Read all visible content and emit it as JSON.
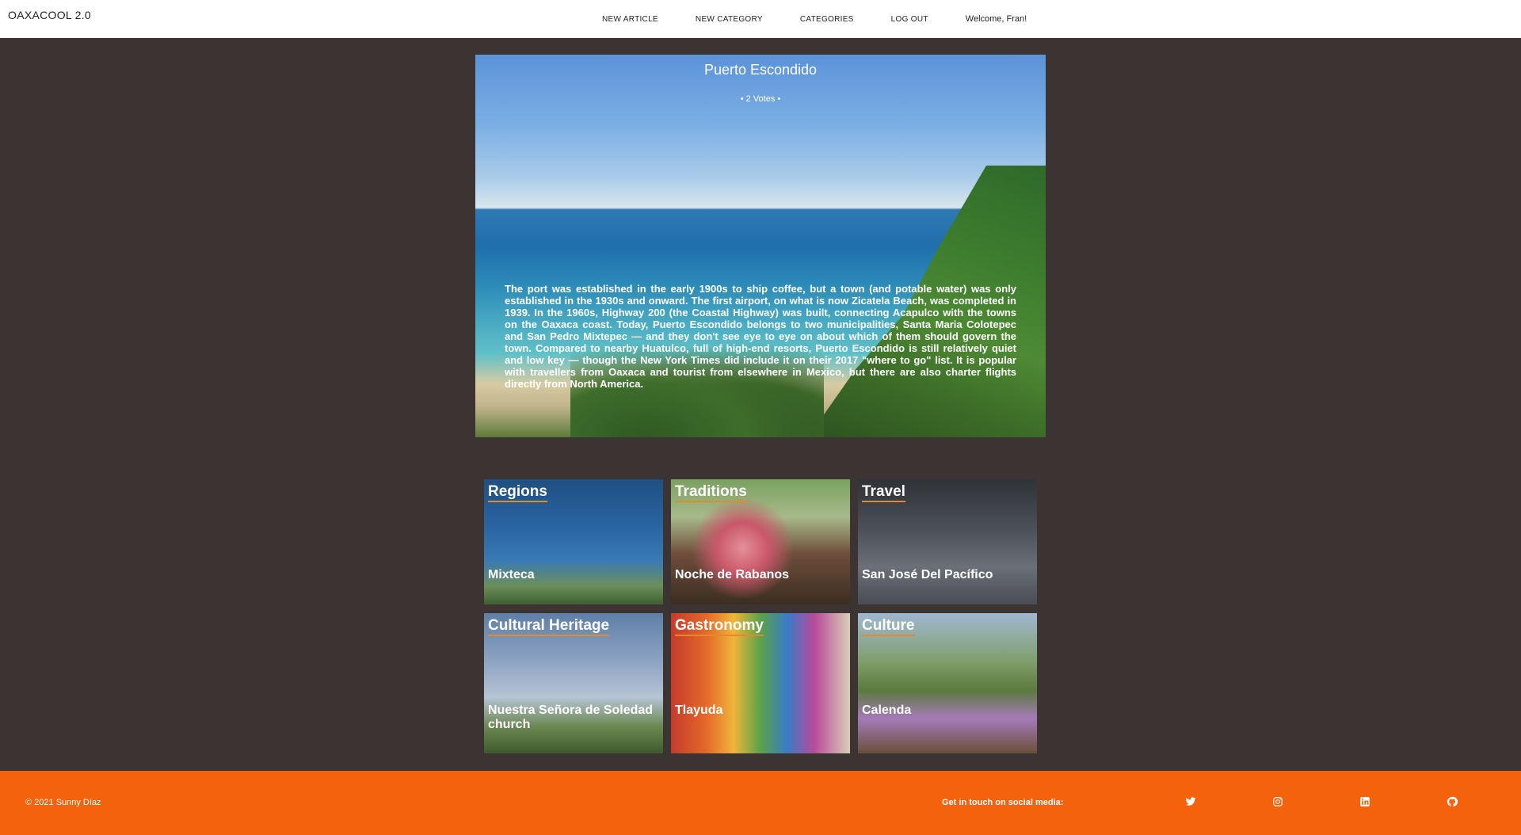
{
  "nav": {
    "brand": "OAXACOOL 2.0",
    "links": [
      "NEW ARTICLE",
      "NEW CATEGORY",
      "CATEGORIES",
      "LOG OUT"
    ],
    "welcome": "Welcome, Fran!"
  },
  "featured": {
    "title": "Puerto Escondido",
    "votes": "• 2 Votes •",
    "body": "The port was established in the early 1900s to ship coffee, but a town (and potable water) was only established in the 1930s and onward. The first airport, on what is now Zicatela Beach, was completed in 1939. In the 1960s, Highway 200 (the Coastal Highway) was built, connecting Acapulco with the towns on the Oaxaca coast. Today, Puerto Escondido belongs to two municipalities, Santa Maria Colotepec and San Pedro Mixtepec — and they don't see eye to eye on about which of them should govern the town. Compared to nearby Huatulco, full of high-end resorts, Puerto Escondido is still relatively quiet and low key — though the New York Times did include it on their 2017 \"where to go\" list. It is popular with travellers from Oaxaca and tourist from elsewhere in Mexico, but there are also charter flights directly from North America."
  },
  "categories": [
    {
      "title": "Regions",
      "article": "Mixteca"
    },
    {
      "title": "Traditions",
      "article": "Noche de Rabanos"
    },
    {
      "title": "Travel",
      "article": "San José Del Pacífico"
    },
    {
      "title": "Cultural Heritage",
      "article": "Nuestra Señora de Soledad church"
    },
    {
      "title": "Gastronomy",
      "article": "Tlayuda"
    },
    {
      "title": "Culture",
      "article": "Calenda"
    }
  ],
  "footer": {
    "copyright": "© 2021 Sunny Díaz",
    "social_label": "Get in touch on social media:",
    "icons": [
      "twitter-icon",
      "instagram-icon",
      "linkedin-icon",
      "github-icon"
    ],
    "color": "#f4620c"
  }
}
